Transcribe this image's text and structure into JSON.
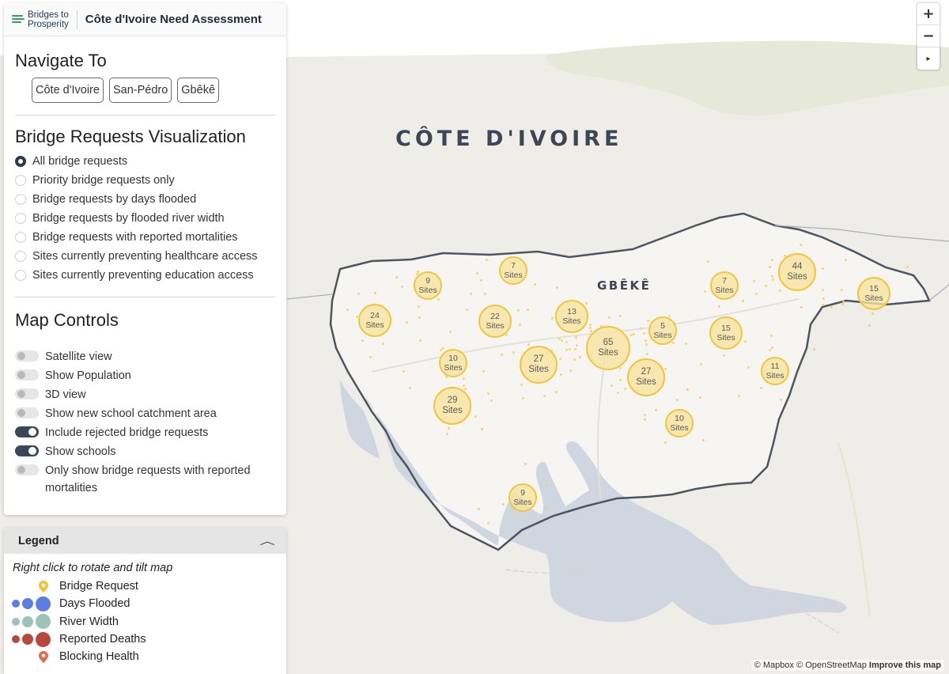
{
  "app": {
    "logo_line1": "Bridges to",
    "logo_line2": "Prosperity",
    "title": "Côte d'Ivoire Need Assessment"
  },
  "navigate": {
    "heading": "Navigate To",
    "buttons": [
      "Côte d'Ivoire",
      "San-Pédro",
      "Gbêkê"
    ]
  },
  "visualization": {
    "heading": "Bridge Requests Visualization",
    "selected_index": 0,
    "options": [
      "All bridge requests",
      "Priority bridge requests only",
      "Bridge requests by days flooded",
      "Bridge requests by flooded river width",
      "Bridge requests with reported mortalities",
      "Sites currently preventing healthcare access",
      "Sites currently preventing education access"
    ]
  },
  "map_controls": {
    "heading": "Map Controls",
    "toggles": [
      {
        "label": "Satellite view",
        "on": false
      },
      {
        "label": "Show Population",
        "on": false
      },
      {
        "label": "3D view",
        "on": false
      },
      {
        "label": "Show new school catchment area",
        "on": false
      },
      {
        "label": "Include rejected bridge requests",
        "on": true
      },
      {
        "label": "Show schools",
        "on": true
      },
      {
        "label": "Only show bridge requests with reported mortalities",
        "on": false
      }
    ]
  },
  "legend": {
    "title": "Legend",
    "hint": "Right click to rotate and tilt map",
    "items": [
      {
        "label": "Bridge Request",
        "icon": "yellow-pin-icon",
        "color": "#f2c232"
      },
      {
        "label": "Days Flooded",
        "icon": "blue-circles-icon",
        "color": "#5b7fe0"
      },
      {
        "label": "River Width",
        "icon": "teal-circles-icon",
        "color": "#9fc2b8"
      },
      {
        "label": "Reported Deaths",
        "icon": "red-circles-icon",
        "color": "#b9473c"
      },
      {
        "label": "Blocking Health",
        "icon": "orange-pin-icon",
        "color": "#e36a4d"
      }
    ]
  },
  "map": {
    "country_label": "CÔTE D'IVOIRE",
    "region_label": "GBÊKÊ",
    "cluster_unit": "Sites",
    "clusters": [
      7,
      9,
      44,
      7,
      15,
      24,
      22,
      13,
      5,
      15,
      65,
      10,
      27,
      27,
      11,
      29,
      10,
      9
    ],
    "zoom_in": "+",
    "zoom_out": "−",
    "compass": "▸"
  },
  "attribution": {
    "mapbox": "© Mapbox",
    "osm": "© OpenStreetMap",
    "improve": "Improve this map"
  }
}
